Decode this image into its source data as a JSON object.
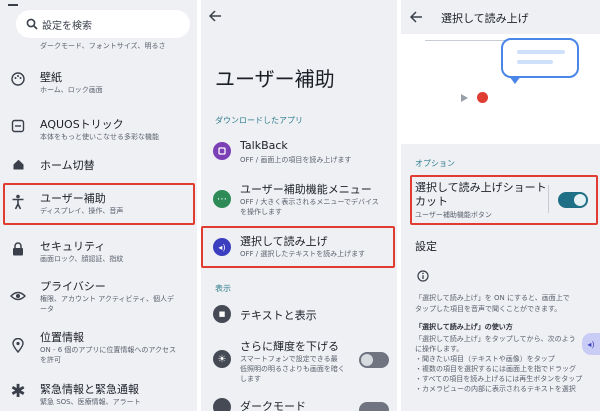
{
  "p1": {
    "search_placeholder": "設定を検索",
    "top_partial": "ダークモード、フォントサイズ、明るさ",
    "items": [
      {
        "title": "壁紙",
        "sub": "ホーム、ロック画面"
      },
      {
        "title": "AQUOSトリック",
        "sub": "本体をもっと使いこなせる多彩な機能"
      },
      {
        "title": "ホーム切替",
        "sub": ""
      },
      {
        "title": "ユーザー補助",
        "sub": "ディスプレイ、操作、音声"
      },
      {
        "title": "セキュリティ",
        "sub": "画面ロック、顔認証、指紋"
      },
      {
        "title": "プライバシー",
        "sub1": "権限、アカウント アクティビティ、個人デ",
        "sub2": "ータ"
      },
      {
        "title": "位置情報",
        "sub1": "ON - 6 個のアプリに位置情報へのアクセス",
        "sub2": "を許可"
      },
      {
        "title": "緊急情報と緊急通報",
        "sub": "緊急 SOS、医療情報、アラート"
      }
    ]
  },
  "p2": {
    "title": "ユーザー補助",
    "section_downloaded": "ダウンロードしたアプリ",
    "talkback": {
      "title": "TalkBack",
      "sub": "OFF / 画面上の項目を読み上げます"
    },
    "menu": {
      "title": "ユーザー補助機能メニュー",
      "sub1": "OFF / 大きく表示されるメニューでデバイス",
      "sub2": "を操作します"
    },
    "s2s": {
      "title": "選択して読み上げ",
      "sub": "OFF / 選択したテキストを読み上げます"
    },
    "section_display": "表示",
    "text_display": "テキストと表示",
    "dim": {
      "title": "さらに輝度を下げる",
      "sub1": "スマートフォンで設定できる最",
      "sub2": "低照明の明るさよりも画面を暗く",
      "sub3": "します"
    },
    "dark": "ダークモード"
  },
  "p3": {
    "title": "選択して読み上げ",
    "section_option": "オプション",
    "shortcut": {
      "title1": "選択して読み上げショート",
      "title2": "カット",
      "sub": "ユーザー補助機能ボタン"
    },
    "settings": "設定",
    "desc": [
      "「選択して読み上げ」を ON にすると、画面上で",
      "タップした項目を音声で聞くことができます。"
    ],
    "howto_title": "「選択して読み上げ」の使い方",
    "howto": [
      "「選択して読み上げ」をタップしてから、次のよう",
      "に操作します。",
      "・聞きたい項目（テキストや画像）をタップ",
      "・複数の項目を選択するには画面上を指でドラッグ",
      "・すべての項目を読み上げるには再生ボタンをタップ",
      "・カメラビューの内部に表示されるテキストを選択"
    ]
  },
  "colors": {
    "highlight": "#e03c31",
    "toggle_on": "#1f6f86",
    "accent_text": "#2f7d8c"
  }
}
